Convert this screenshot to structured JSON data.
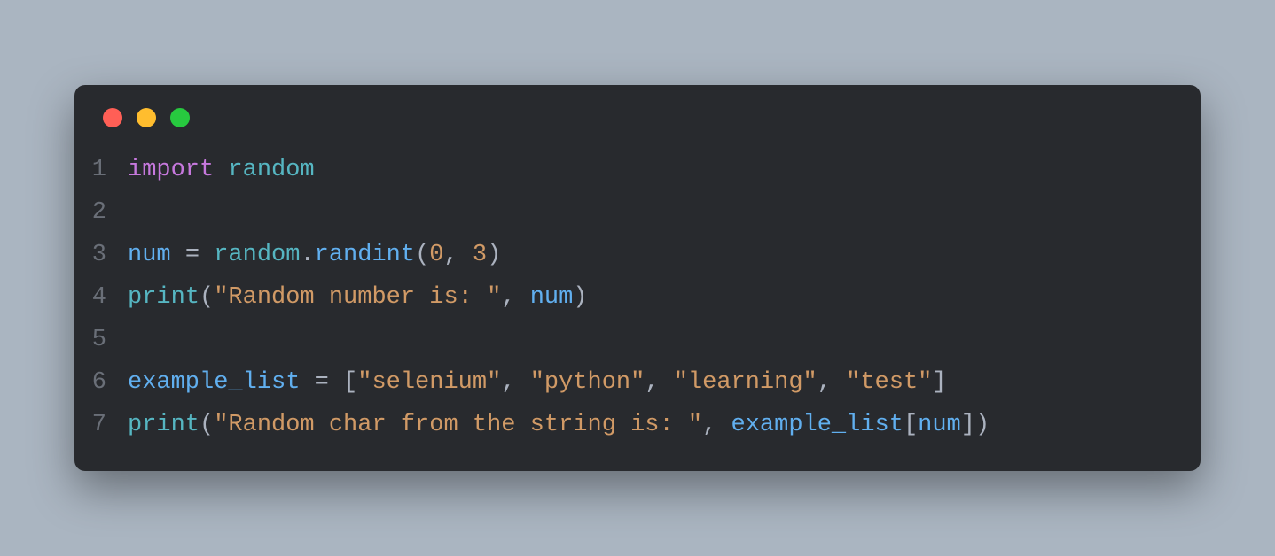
{
  "window": {
    "traffic_lights": [
      "red",
      "yellow",
      "green"
    ]
  },
  "code": {
    "lines": [
      {
        "num": "1"
      },
      {
        "num": "2"
      },
      {
        "num": "3"
      },
      {
        "num": "4"
      },
      {
        "num": "5"
      },
      {
        "num": "6"
      },
      {
        "num": "7"
      }
    ],
    "tokens": {
      "l1": {
        "import": "import",
        "sp": " ",
        "random": "random"
      },
      "l3": {
        "num": "num",
        "sp": " ",
        "eq": "=",
        "random": "random",
        "dot": ".",
        "randint": "randint",
        "lp": "(",
        "zero": "0",
        "comma": ",",
        "three": "3",
        "rp": ")"
      },
      "l4": {
        "print": "print",
        "lp": "(",
        "str": "\"Random number is: \"",
        "comma": ",",
        "sp": " ",
        "num": "num",
        "rp": ")"
      },
      "l6": {
        "var": "example_list",
        "sp": " ",
        "eq": "=",
        "lb": "[",
        "s1": "\"selenium\"",
        "c": ",",
        "s2": "\"python\"",
        "s3": "\"learning\"",
        "s4": "\"test\"",
        "rb": "]"
      },
      "l7": {
        "print": "print",
        "lp": "(",
        "str": "\"Random char from the string is: \"",
        "comma": ",",
        "sp": " ",
        "var": "example_list",
        "lb": "[",
        "num": "num",
        "rb": "]",
        "rp": ")"
      }
    }
  }
}
